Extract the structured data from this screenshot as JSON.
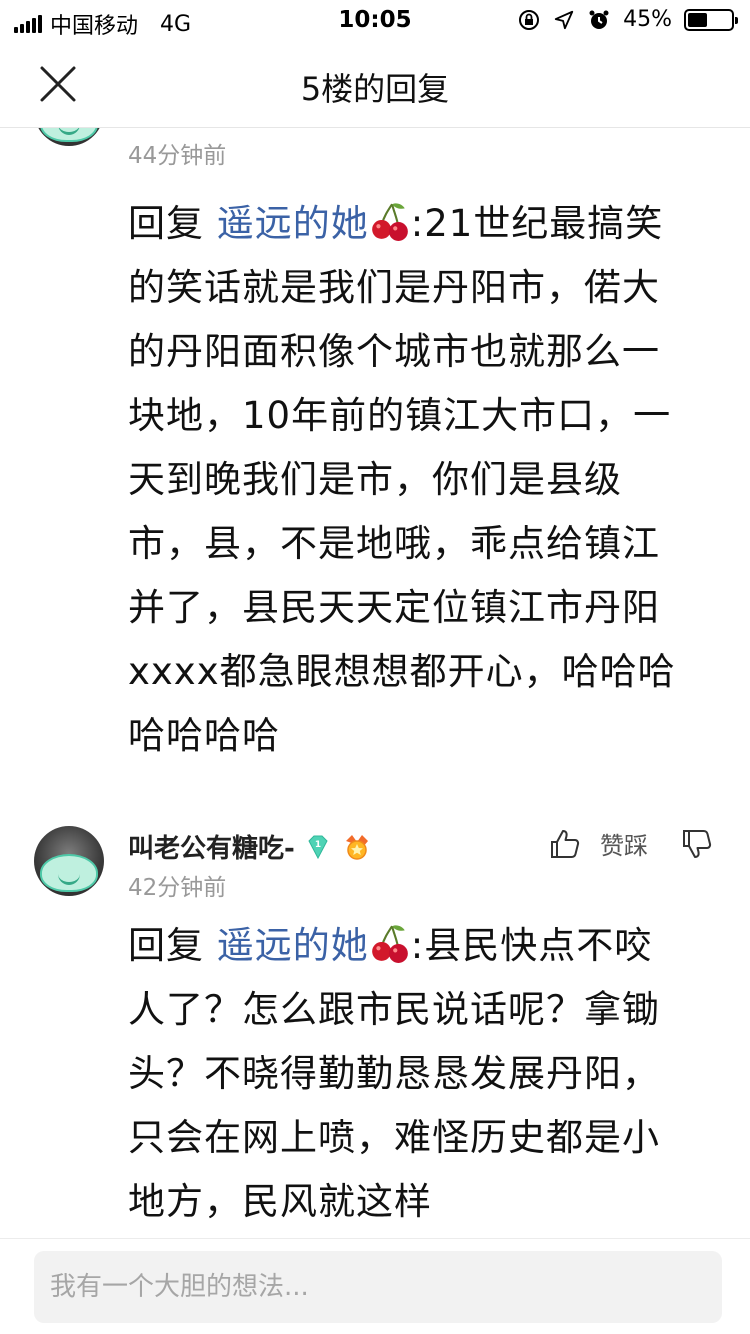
{
  "status_bar": {
    "carrier": "中国移动",
    "network": "4G",
    "time": "10:05",
    "battery_text": "45%",
    "battery_level": 0.45
  },
  "nav": {
    "title": "5楼的回复",
    "close_icon": "close-icon"
  },
  "posts": [
    {
      "time_ago": "44分钟前",
      "reply_prefix": "回复",
      "mention": "遥远的她",
      "body": ":21世纪最搞笑的笑话就是我们是丹阳市，偌大的丹阳面积像个城市也就那么一块地，10年前的镇江大市口，一天到晚我们是市，你们是县级市，县，不是地哦，乖点给镇江并了，县民天天定位镇江市丹阳xxxx都急眼想想都开心，哈哈哈哈哈哈哈"
    },
    {
      "username": "叫老公有糖吃-",
      "time_ago": "42分钟前",
      "actions_label": "赞踩",
      "diamond_level": "1",
      "reply_prefix": "回复",
      "mention": "遥远的她",
      "body": ":县民快点不咬人了？怎么跟市民说话呢？拿锄头？不晓得勤勤恳恳发展丹阳，只会在网上喷，难怪历史都是小地方，民风就这样"
    }
  ],
  "composer": {
    "placeholder": "我有一个大胆的想法..."
  },
  "colors": {
    "mention": "#3b62a6",
    "secondary_text": "#999999",
    "avatar_mask": "#bff0df"
  }
}
